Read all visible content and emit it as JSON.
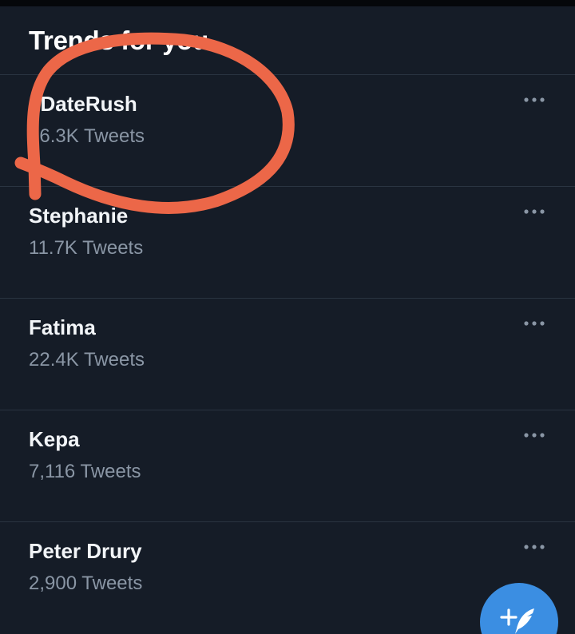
{
  "trends": {
    "heading": "Trends for you",
    "items": [
      {
        "name": "#DateRush",
        "count": "16.3K Tweets",
        "more_icon": "more-horizontal-icon"
      },
      {
        "name": "Stephanie",
        "count": "11.7K Tweets",
        "more_icon": "more-horizontal-icon"
      },
      {
        "name": "Fatima",
        "count": "22.4K Tweets",
        "more_icon": "more-horizontal-icon"
      },
      {
        "name": "Kepa",
        "count": "7,116 Tweets",
        "more_icon": "more-horizontal-icon"
      },
      {
        "name": "Peter Drury",
        "count": "2,900 Tweets",
        "more_icon": "more-horizontal-icon"
      }
    ]
  },
  "compose": {
    "icon": "compose-tweet-icon",
    "color": "#3b8ee2"
  },
  "annotation": {
    "type": "hand-drawn circle",
    "color": "#ec6748"
  },
  "colors": {
    "background": "#151c27",
    "primary_text": "#f2f5f8",
    "secondary_text": "#8a96a5",
    "divider": "#2a3441"
  }
}
